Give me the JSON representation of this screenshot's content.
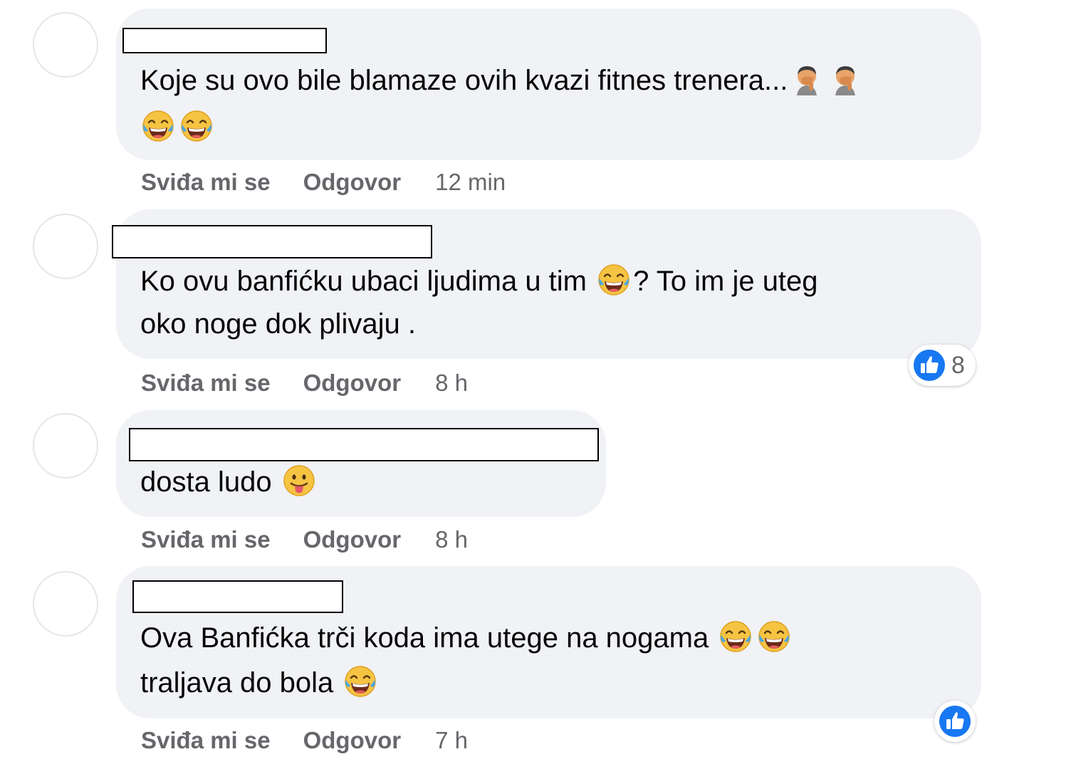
{
  "colors": {
    "bubble": "#f0f2f5",
    "action_text": "#65676b",
    "like_blue": "#1877f2",
    "emoji_yellow": "#f6c443"
  },
  "comments": [
    {
      "text_lines": [
        "Koje su ovo bile blamaze ovih kvazi fitnes trenera..."
      ],
      "emojis": [
        "facepalm-emoji",
        "facepalm-emoji",
        "laughing-tears-emoji",
        "laughing-tears-emoji"
      ],
      "actions": {
        "like": "Sviđa mi se",
        "reply": "Odgovor",
        "time": "12 min"
      }
    },
    {
      "text_lines": [
        "Ko ovu banfićku ubaci ljudima u tim",
        "? To im je uteg",
        "oko noge dok plivaju ."
      ],
      "emojis": [
        "laughing-tears-emoji"
      ],
      "reaction": {
        "icon": "like-icon",
        "count": "8"
      },
      "actions": {
        "like": "Sviđa mi se",
        "reply": "Odgovor",
        "time": "8 h"
      }
    },
    {
      "text_lines": [
        "dosta ludo"
      ],
      "emojis": [
        "tongue-out-emoji"
      ],
      "actions": {
        "like": "Sviđa mi se",
        "reply": "Odgovor",
        "time": "8 h"
      }
    },
    {
      "text_lines": [
        "Ova Banfićka trči koda ima utege na nogama",
        "traljava do bola"
      ],
      "emojis": [
        "laughing-tears-emoji",
        "laughing-tears-emoji",
        "laughing-tears-emoji"
      ],
      "reaction": {
        "icon": "like-icon"
      },
      "actions": {
        "like": "Sviđa mi se",
        "reply": "Odgovor",
        "time": "7 h"
      }
    }
  ]
}
